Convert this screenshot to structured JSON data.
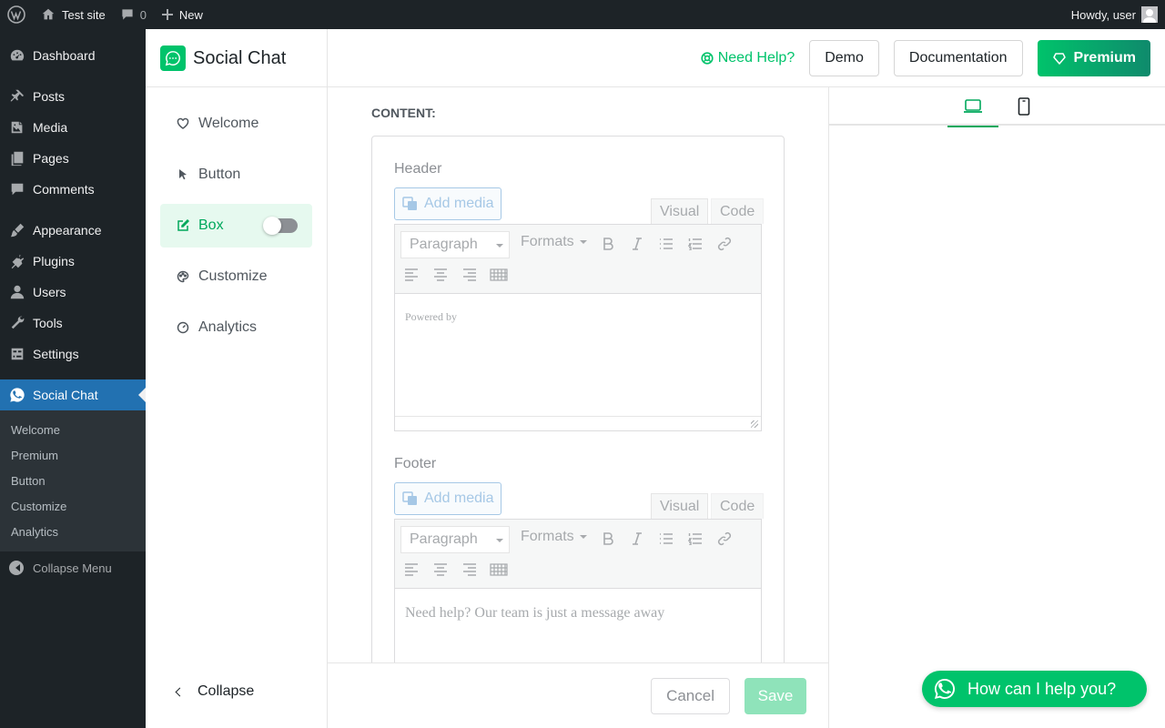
{
  "admin_bar": {
    "site_name": "Test site",
    "comments_count": "0",
    "new_label": "New",
    "greeting": "Howdy, user"
  },
  "admin_menu": {
    "items": [
      {
        "label": "Dashboard",
        "icon": "dashboard-icon"
      },
      {
        "label": "Posts",
        "icon": "pin-icon"
      },
      {
        "label": "Media",
        "icon": "media-icon"
      },
      {
        "label": "Pages",
        "icon": "pages-icon"
      },
      {
        "label": "Comments",
        "icon": "comment-icon"
      },
      {
        "label": "Appearance",
        "icon": "brush-icon"
      },
      {
        "label": "Plugins",
        "icon": "plugin-icon"
      },
      {
        "label": "Users",
        "icon": "user-icon"
      },
      {
        "label": "Tools",
        "icon": "wrench-icon"
      },
      {
        "label": "Settings",
        "icon": "settings-icon"
      },
      {
        "label": "Social Chat",
        "icon": "whatsapp-icon"
      }
    ],
    "submenu": [
      "Welcome",
      "Premium",
      "Button",
      "Customize",
      "Analytics"
    ],
    "collapse_label": "Collapse Menu"
  },
  "plugin_header": {
    "title": "Social Chat",
    "help_label": "Need Help?",
    "demo_label": "Demo",
    "docs_label": "Documentation",
    "premium_label": "Premium"
  },
  "plugin_nav": {
    "items": [
      {
        "label": "Welcome",
        "icon": "heart-icon"
      },
      {
        "label": "Button",
        "icon": "cursor-icon"
      },
      {
        "label": "Box",
        "icon": "edit-box-icon",
        "active": true,
        "toggle": false
      },
      {
        "label": "Customize",
        "icon": "palette-icon"
      },
      {
        "label": "Analytics",
        "icon": "gauge-icon"
      }
    ],
    "collapse_label": "Collapse"
  },
  "content": {
    "section_label": "CONTENT:",
    "header_editor": {
      "label": "Header",
      "add_media": "Add media",
      "tab_visual": "Visual",
      "tab_code": "Code",
      "format_select": "Paragraph",
      "formats_label": "Formats",
      "text": "Powered by"
    },
    "footer_editor": {
      "label": "Footer",
      "add_media": "Add media",
      "tab_visual": "Visual",
      "tab_code": "Code",
      "format_select": "Paragraph",
      "formats_label": "Formats",
      "text": "Need help? Our team is just a message away"
    }
  },
  "actions": {
    "cancel_label": "Cancel",
    "save_label": "Save"
  },
  "preview": {
    "devices": [
      "laptop-icon",
      "mobile-icon"
    ],
    "chat_button_label": "How can I help you?"
  },
  "colors": {
    "accent": "#00c36b",
    "wp_dark": "#1d2327",
    "wp_blue": "#2271b1"
  }
}
